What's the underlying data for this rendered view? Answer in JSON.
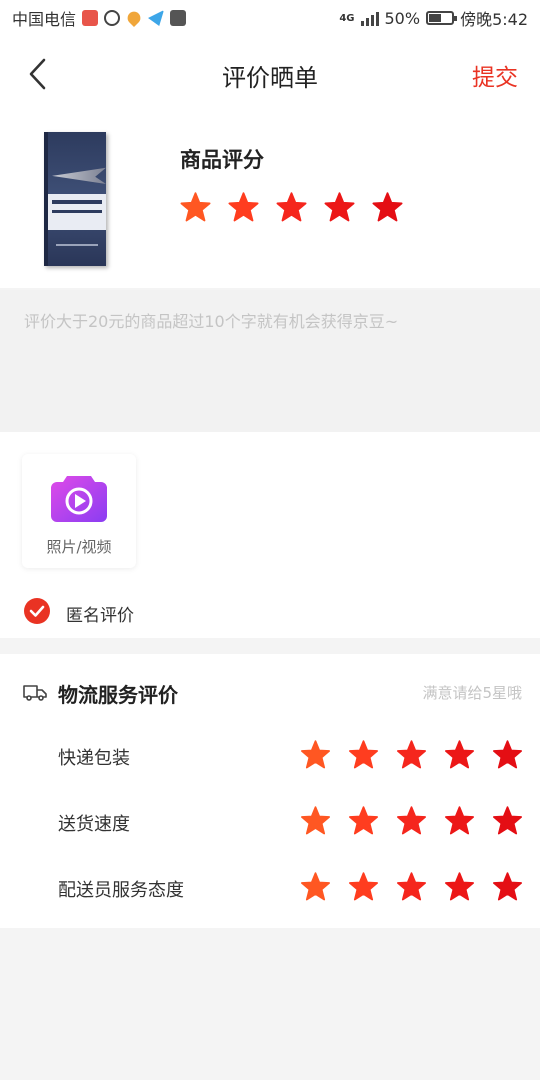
{
  "status_bar": {
    "carrier": "中国电信",
    "network": "4G",
    "battery": "50%",
    "battery_level": 0.5,
    "time": "傍晚5:42"
  },
  "nav": {
    "title": "评价晒单",
    "submit_label": "提交"
  },
  "product": {
    "score_title": "商品评分",
    "rating": 5,
    "max_rating": 5
  },
  "review": {
    "placeholder": "评价大于20元的商品超过10个字就有机会获得京豆~"
  },
  "media": {
    "upload_label": "照片/视频"
  },
  "anonymous": {
    "label": "匿名评价",
    "checked": true
  },
  "logistics": {
    "title": "物流服务评价",
    "hint": "满意请给5星哦",
    "items": [
      {
        "label": "快递包装",
        "rating": 5
      },
      {
        "label": "送货速度",
        "rating": 5
      },
      {
        "label": "配送员服务态度",
        "rating": 5
      }
    ]
  },
  "colors": {
    "accent": "#e93323",
    "star_gradient": [
      "#ff5722",
      "#ff3d1f",
      "#f5261d",
      "#ec1717",
      "#e40e14"
    ]
  }
}
